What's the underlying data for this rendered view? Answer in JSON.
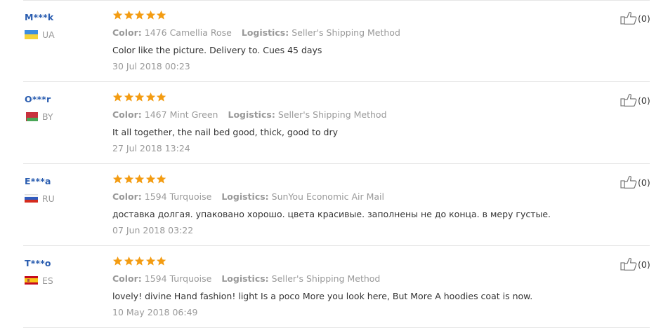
{
  "reviews": [
    {
      "buyer": "M***k",
      "country": "UA",
      "flag": "ua",
      "color_label": "Color:",
      "color_value": "1476 Camellia Rose",
      "logistics_label": "Logistics:",
      "logistics_value": "Seller's Shipping Method",
      "text": "Color like the picture. Delivery to. Cues 45 days",
      "date": "30 Jul 2018 00:23",
      "helpful": "(0)",
      "rating": 5
    },
    {
      "buyer": "O***r",
      "country": "BY",
      "flag": "by",
      "color_label": "Color:",
      "color_value": "1467 Mint Green",
      "logistics_label": "Logistics:",
      "logistics_value": "Seller's Shipping Method",
      "text": "It all together, the nail bed good, thick, good to dry",
      "date": "27 Jul 2018 13:24",
      "helpful": "(0)",
      "rating": 5
    },
    {
      "buyer": "E***a",
      "country": "RU",
      "flag": "ru",
      "color_label": "Color:",
      "color_value": "1594 Turquoise",
      "logistics_label": "Logistics:",
      "logistics_value": "SunYou Economic Air Mail",
      "text": "доставка долгая. упаковано хорошо. цвета красивые. заполнены не до конца. в меру густые.",
      "date": "07 Jun 2018 03:22",
      "helpful": "(0)",
      "rating": 5
    },
    {
      "buyer": "T***o",
      "country": "ES",
      "flag": "es",
      "color_label": "Color:",
      "color_value": "1594 Turquoise",
      "logistics_label": "Logistics:",
      "logistics_value": "Seller's Shipping Method",
      "text": "lovely! divine Hand fashion! light Is a poco More you look here, But More A hoodies coat is now.",
      "date": "10 May 2018 06:49",
      "helpful": "(0)",
      "rating": 5
    }
  ],
  "colors": {
    "star": "#f39c12",
    "buyer": "#2a5db0",
    "muted": "#999999",
    "text": "#333333",
    "divider": "#e6e6e6"
  },
  "icons": {
    "rating": "star-icon",
    "helpful": "thumbs-up-icon"
  }
}
